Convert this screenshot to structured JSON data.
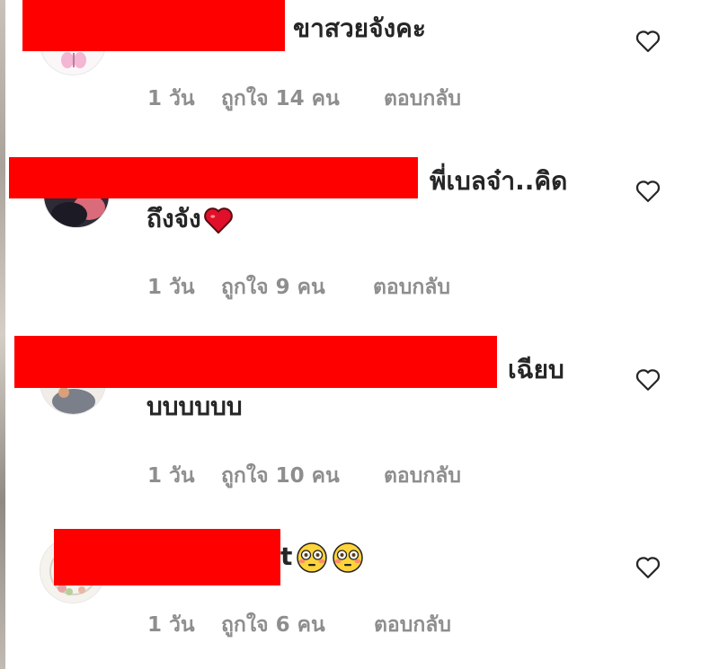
{
  "comments": [
    {
      "text": "ขาสวยจังคะ",
      "age": "1 วัน",
      "likes": "ถูกใจ 14 คน",
      "reply": "ตอบกลับ"
    },
    {
      "text_line1": "พี่เบลจ๋า..คิด",
      "text_line2": "ถึงจัง",
      "age": "1 วัน",
      "likes": "ถูกใจ 9 คน",
      "reply": "ตอบกลับ"
    },
    {
      "text_line1": "เฉียบ",
      "text_line2": "บบบบบบ",
      "age": "1 วัน",
      "likes": "ถูกใจ 10 คน",
      "reply": "ตอบกลับ"
    },
    {
      "text": "t",
      "age": "1 วัน",
      "likes": "ถูกใจ 6 คน",
      "reply": "ตอบกลับ"
    }
  ],
  "icons": {
    "like": "heart-outline-icon",
    "emoji_heart": "red-heart-emoji",
    "emoji_flushed": "flushed-face-emoji"
  },
  "colors": {
    "text": "#262626",
    "meta": "#8e8e8e",
    "redaction": "#ff0000"
  }
}
